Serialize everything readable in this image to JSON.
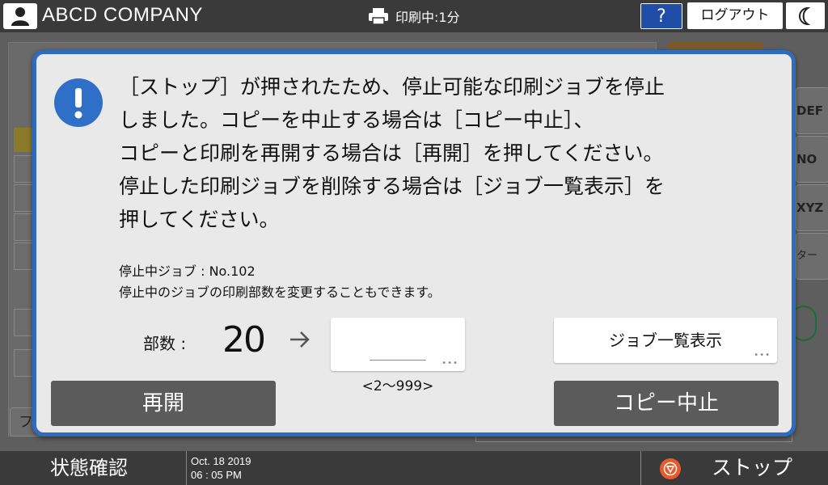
{
  "header": {
    "company": "ABCD COMPANY",
    "print_status": "印刷中:1分",
    "help_label": "?",
    "logout_label": "ログアウト"
  },
  "background": {
    "side_keys": [
      "DEF",
      "NO",
      "XYZ",
      "ター"
    ],
    "bottom_left_char": "フ"
  },
  "dialog": {
    "message_lines": [
      "［ストップ］が押されたため、停止可能な印刷ジョブを停止",
      "しました。コピーを中止する場合は［コピー中止］、",
      "コピーと印刷を再開する場合は［再開］を押してください。",
      "停止した印刷ジョブを削除する場合は［ジョブ一覧表示］を",
      "押してください。"
    ],
    "stopped_job": "停止中ジョブ : No.102",
    "change_copies_note": "停止中のジョブの印刷部数を変更することもできます。",
    "copies_label": "部数 :",
    "copies_value": "20",
    "copies_input_value": "",
    "copies_range": "<2～999>",
    "job_list_button": "ジョブ一覧表示",
    "resume_button": "再開",
    "cancel_copy_button": "コピー中止"
  },
  "footer": {
    "status_check": "状態確認",
    "date": "Oct. 18 2019",
    "time": "06 : 05 PM",
    "stop_label": "ストップ"
  },
  "colors": {
    "accent_blue": "#2e6bc1",
    "stop_orange": "#e85a2a",
    "help_blue": "#1f4da8"
  }
}
